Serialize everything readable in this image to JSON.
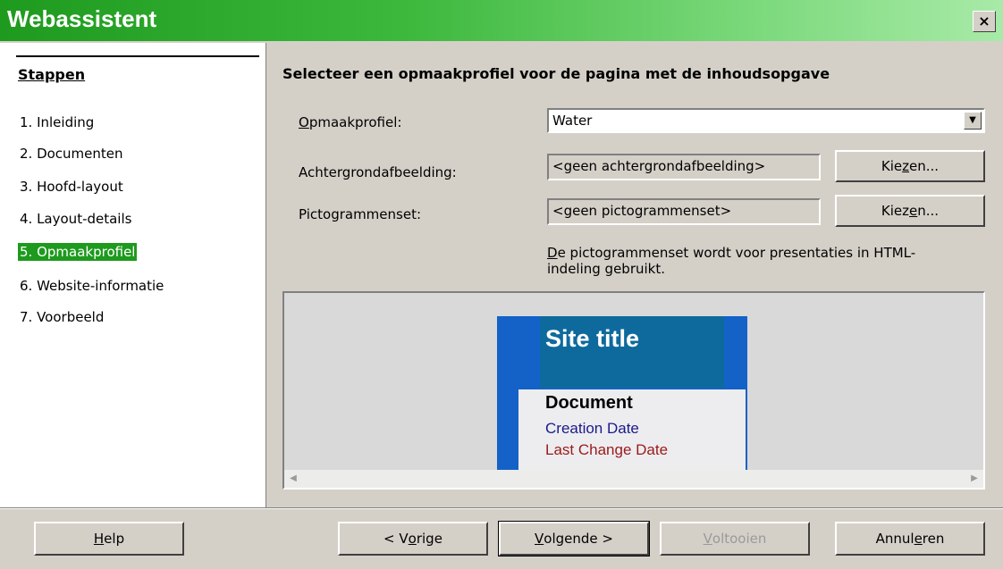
{
  "window": {
    "title": "Webassistent",
    "close_glyph": "×"
  },
  "sidebar": {
    "title": "Stappen",
    "steps": [
      {
        "label": "1. Inleiding"
      },
      {
        "label": "2. Documenten"
      },
      {
        "label": "3. Hoofd-layout"
      },
      {
        "label": "4. Layout-details"
      },
      {
        "label": "5. Opmaakprofiel",
        "active": true
      },
      {
        "label": "6. Website-informatie"
      },
      {
        "label": "7. Voorbeeld"
      }
    ]
  },
  "main": {
    "heading": "Selecteer een opmaakprofiel voor de pagina met de inhoudsopgave",
    "style": {
      "label_mnemonic": "O",
      "label_rest": "pmaakprofiel:",
      "value": "Water"
    },
    "background": {
      "label": "Achtergrondafbeelding:",
      "value": "<geen achtergrondafbeelding>",
      "button_pre": "Kie",
      "button_mnemonic": "z",
      "button_post": "en..."
    },
    "iconset": {
      "label": "Pictogrammenset:",
      "value": "<geen pictogrammenset>",
      "button_pre": "Kiez",
      "button_mnemonic": "e",
      "button_post": "n..."
    },
    "note": {
      "mnemonic": "D",
      "rest": "e pictogrammenset wordt voor presentaties in HTML-indeling gebruikt."
    }
  },
  "preview": {
    "site_title": "Site title",
    "document": "Document",
    "creation_date": "Creation Date",
    "last_change_date": "Last Change Date",
    "colors": {
      "frame": "#1462c8",
      "header": "#0e6a9c",
      "creation": "#1a1a8a",
      "last_change": "#9a1a1a"
    }
  },
  "footer": {
    "help": {
      "mnemonic": "H",
      "rest": "elp"
    },
    "prev": {
      "pre": "< V",
      "mnemonic": "o",
      "post": "rige"
    },
    "next": {
      "mnemonic": "V",
      "post": "olgende >"
    },
    "finish": {
      "mnemonic": "V",
      "post": "oltooien"
    },
    "cancel": {
      "pre": "Annul",
      "mnemonic": "e",
      "post": "ren"
    }
  }
}
